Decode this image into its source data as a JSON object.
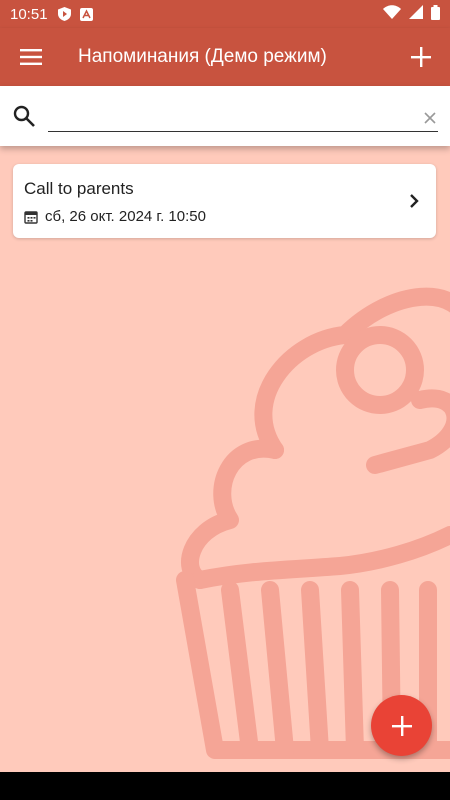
{
  "status_bar": {
    "time": "10:51"
  },
  "app_bar": {
    "title": "Напоминания (Демо режим)"
  },
  "search": {
    "value": "",
    "placeholder": ""
  },
  "reminders": [
    {
      "title": "Call to parents",
      "date": "сб, 26 окт. 2024 г. 10:50"
    }
  ],
  "colors": {
    "primary": "#c8533f",
    "background": "#ffcabb",
    "fab": "#e94336",
    "art": "#f5a596"
  },
  "icons": {
    "menu": "menu-icon",
    "add": "plus-icon",
    "search": "search-icon",
    "clear": "close-icon",
    "calendar": "calendar-icon",
    "chevron": "chevron-right-icon",
    "fab": "plus-icon"
  }
}
